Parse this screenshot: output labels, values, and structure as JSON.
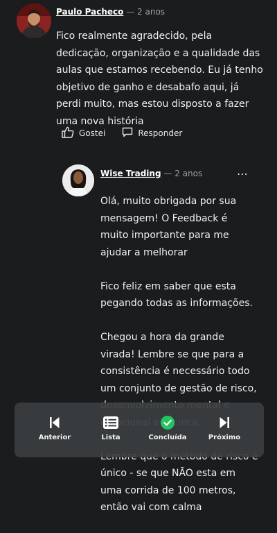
{
  "comment": {
    "author": "Paulo Pacheco",
    "time": "2 anos",
    "text": "Fico realmente agradecido, pela dedicação, organização e a qualidade das aulas que estamos recebendo. Eu já tenho objetivo de ganho e desabafo aqui, já perdi muito, mas estou disposto a fazer uma nova história",
    "like_label": "Gostei",
    "reply_label": "Responder"
  },
  "reply": {
    "author": "Wise Trading",
    "time": "2 anos",
    "more": "⋯",
    "paragraphs": [
      "Olá, muito obrigada por sua mensagem! O Feedback é muito importante para me ajudar a melhorar",
      "Fico feliz em saber que esta pegando todas as informações.",
      "Chegou a hora da grande virada! Lembre se que para a consistência é necessário todo um conjunto de gestão de risco, desenvolvimento mental e emocional e técnica.",
      "Lembre que o método de risco é único - se que NÃO esta em uma corrida de 100 metros, então vai com calma"
    ]
  },
  "nav": {
    "prev": "Anterior",
    "list": "Lista",
    "done": "Concluída",
    "next": "Próximo"
  },
  "colors": {
    "background": "#1a1c1d",
    "navbar": "#3a3d40",
    "done_green": "#22c55e"
  }
}
